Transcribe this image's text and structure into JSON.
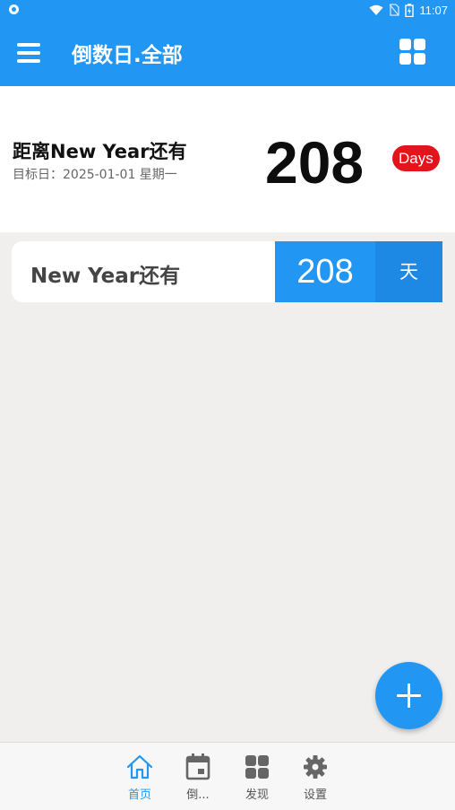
{
  "status_bar": {
    "time": "11:07"
  },
  "app_bar": {
    "title": "倒数日.全部"
  },
  "hero": {
    "title": "距离New Year还有",
    "subtitle": "目标日：2025-01-01 星期一",
    "days": "208",
    "badge": "Days"
  },
  "events": [
    {
      "title": "New Year还有",
      "days": "208",
      "unit": "天"
    }
  ],
  "bottom_nav": {
    "items": [
      {
        "label": "首页",
        "icon": "home-icon",
        "active": true
      },
      {
        "label": "倒...",
        "icon": "calendar-icon",
        "active": false
      },
      {
        "label": "发现",
        "icon": "grid-icon",
        "active": false
      },
      {
        "label": "设置",
        "icon": "gear-icon",
        "active": false
      }
    ]
  },
  "colors": {
    "primary": "#2196f3",
    "primary_dark": "#1e88e5",
    "badge": "#e4141b",
    "background": "#f0efed"
  }
}
